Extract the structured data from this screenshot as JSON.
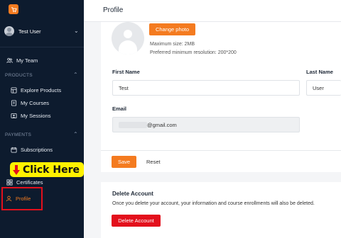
{
  "sidebar": {
    "user_name": "Test User",
    "items": {
      "my_team": "My Team",
      "explore_products": "Explore Products",
      "my_courses": "My Courses",
      "my_sessions": "My Sessions",
      "subscriptions": "Subscriptions",
      "certificates": "Certificates",
      "profile": "Profile"
    },
    "sections": {
      "products": "PRODUCTS",
      "payments": "PAYMENTS"
    }
  },
  "overlay": {
    "click_here": "Click Here"
  },
  "header": {
    "title": "Profile"
  },
  "photo": {
    "change_label": "Change photo",
    "max_size": "Maximum size: 2MB",
    "preferred_res": "Preferred minimum resolution: 200*200"
  },
  "form": {
    "first_name_label": "First Name",
    "first_name_value": "Test",
    "last_name_label": "Last Name",
    "last_name_value": "User",
    "email_label": "Email",
    "email_value": "@gmail.com",
    "save_label": "Save",
    "reset_label": "Reset"
  },
  "delete": {
    "title": "Delete Account",
    "text": "Once you delete your account, your information and course enrollments will also be deleted.",
    "button": "Delete Account"
  },
  "colors": {
    "accent": "#f47b20",
    "danger": "#e3101c",
    "sidebar_bg": "#0d1b2e",
    "highlight": "#fff200"
  }
}
